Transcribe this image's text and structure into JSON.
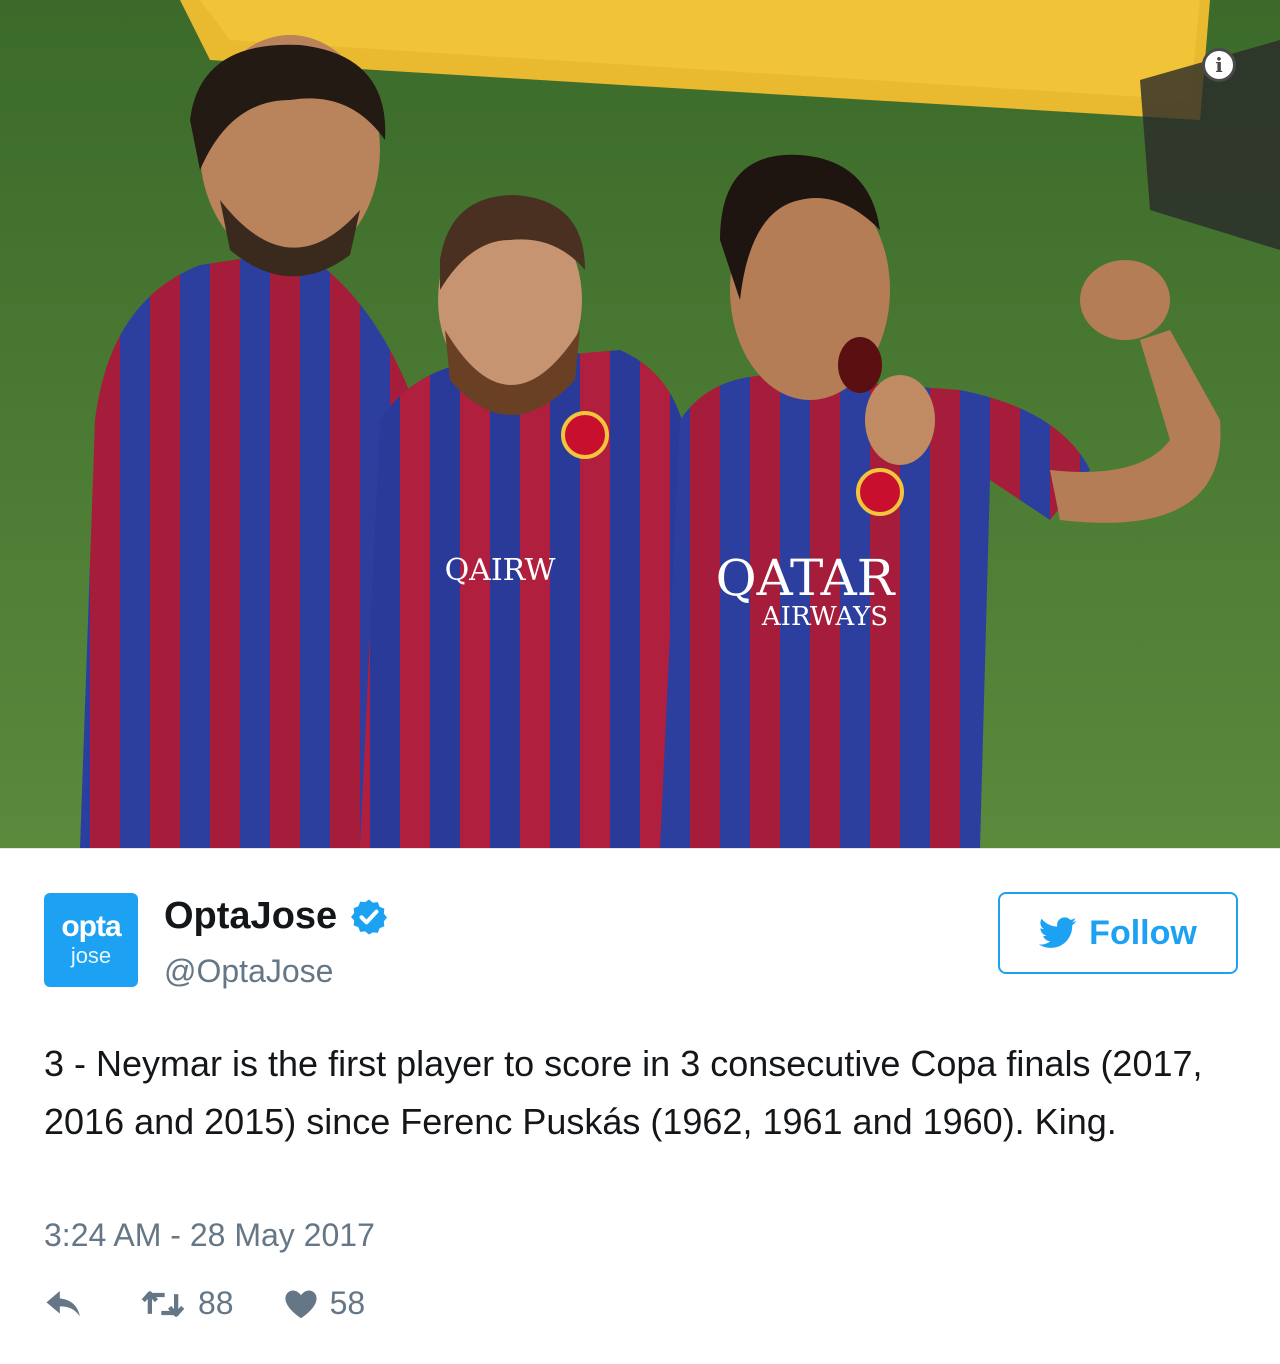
{
  "photo": {
    "sponsor_logo_text": "QATAR",
    "sponsor_logo_subtext": "AIRWAYS",
    "partial_sponsor_text": "QAIRW"
  },
  "tweet": {
    "avatar_line1": "opta",
    "avatar_line2": "jose",
    "display_name": "OptaJose",
    "handle": "@OptaJose",
    "follow_label": "Follow",
    "text": "3 - Neymar is the first player to score in 3 consecutive Copa finals (2017, 2016 and 2015) since Ferenc Puskás (1962, 1961 and 1960). King.",
    "timestamp": "3:24 AM - 28 May 2017",
    "retweet_count": "88",
    "like_count": "58"
  },
  "colors": {
    "twitter_blue": "#1da1f2",
    "muted_gray": "#657786",
    "barca_blue": "#2c3f9e",
    "barca_red": "#a51d3b",
    "pitch_green": "#4c7a35"
  },
  "icons": [
    "info-icon",
    "verified-icon",
    "twitter-bird-icon",
    "reply-icon",
    "retweet-icon",
    "heart-icon"
  ]
}
